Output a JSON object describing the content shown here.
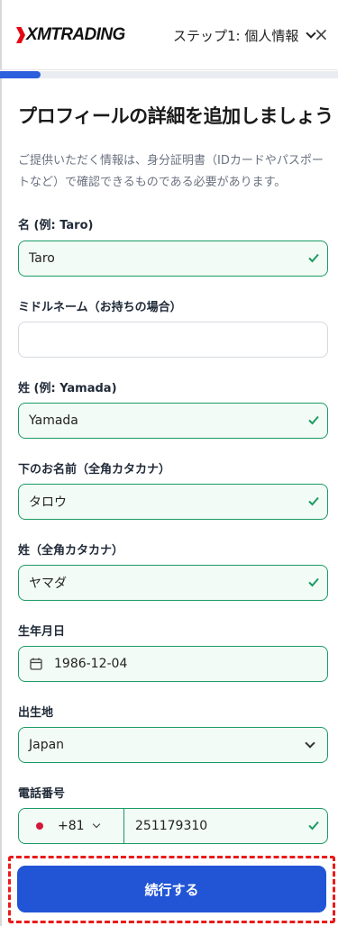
{
  "header": {
    "logo_text": "XMTRADING",
    "step_label": "ステップ1: 個人情報",
    "close_symbol": "×"
  },
  "progress": {
    "fraction": 0.12,
    "color": "#2c5fdc"
  },
  "page": {
    "title": "プロフィールの詳細を追加しましょう",
    "description": "ご提供いただく情報は、身分証明書（IDカードやパスポートなど）で確認できるものである必要があります。"
  },
  "form": {
    "first_name": {
      "label": "名 (例: Taro)",
      "value": "Taro"
    },
    "middle_name": {
      "label": "ミドルネーム（お持ちの場合）",
      "value": ""
    },
    "last_name": {
      "label": "姓 (例: Yamada)",
      "value": "Yamada"
    },
    "first_name_kana": {
      "label": "下のお名前（全角カタカナ）",
      "value": "タロウ"
    },
    "last_name_kana": {
      "label": "姓（全角カタカナ）",
      "value": "ヤマダ"
    },
    "birth_date": {
      "label": "生年月日",
      "value": "1986-12-04"
    },
    "birth_place": {
      "label": "出生地",
      "value": "Japan"
    },
    "phone": {
      "label": "電話番号",
      "country_code": "+81",
      "number": "251179310"
    }
  },
  "actions": {
    "continue_label": "続行する"
  },
  "colors": {
    "accent": "#2155d6",
    "valid_border": "#1a9b63",
    "valid_background": "#f3fbf6",
    "highlight_dashed": "#ea1a1a",
    "logo_red": "#e30613"
  },
  "icons": {
    "check": "check-icon",
    "calendar": "calendar-icon",
    "chevron": "chevron-down-icon",
    "close": "close-icon",
    "flag": "japan-flag-icon"
  }
}
